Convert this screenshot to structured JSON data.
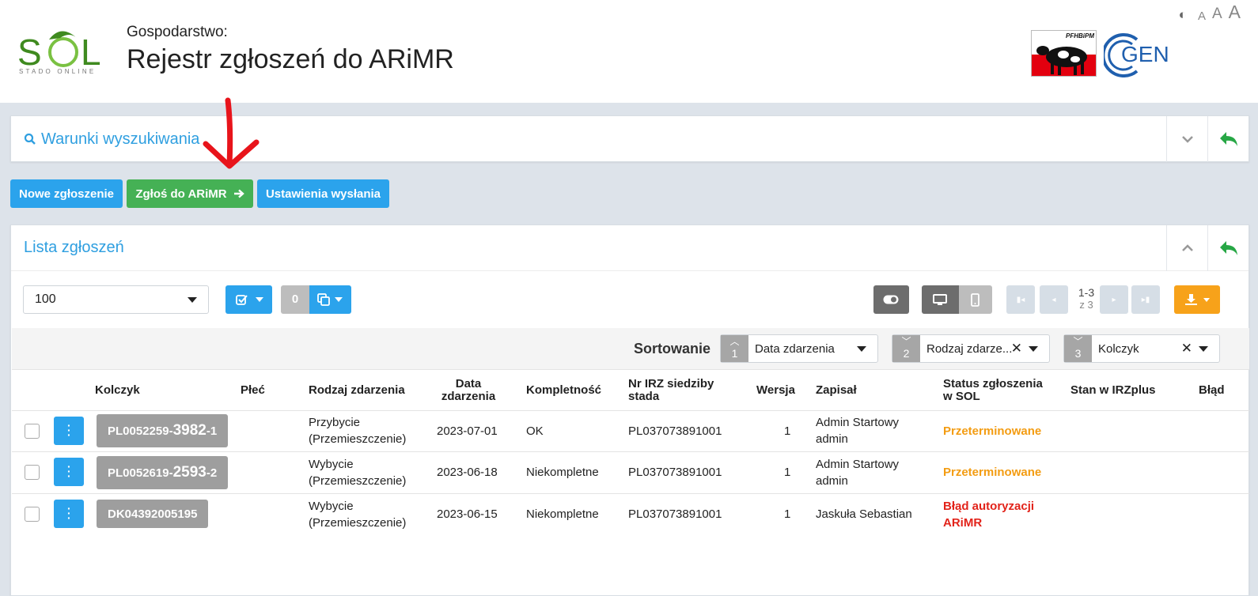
{
  "header": {
    "logo_text": "SOL",
    "logo_subtitle": "STADO ONLINE",
    "farm_label": "Gospodarstwo:",
    "title": "Rejestr zgłoszeń do ARiMR",
    "partner_logo_1": "PFHBiPM",
    "partner_logo_2": "CGEN",
    "a11y": {
      "contrast_icon": "contrast-icon",
      "font_small": "A",
      "font_medium": "A",
      "font_large": "A"
    }
  },
  "search_panel": {
    "title": "Warunki wyszukiwania",
    "icon": "search-icon"
  },
  "actions": {
    "new_report": "Nowe zgłoszenie",
    "send_to_arimr": "Zgłoś do ARiMR",
    "send_settings": "Ustawienia wysłania"
  },
  "list_panel": {
    "title": "Lista zgłoszeń",
    "page_size": "100",
    "selected_count": "0",
    "pagination": {
      "range": "1-3",
      "of_label": "z 3"
    }
  },
  "sorting": {
    "label": "Sortowanie",
    "fields": [
      {
        "num": "1",
        "dir": "asc",
        "value": "Data zdarzenia"
      },
      {
        "num": "2",
        "dir": "desc",
        "value": "Rodzaj zdarze..."
      },
      {
        "num": "3",
        "dir": "desc",
        "value": "Kolczyk"
      }
    ]
  },
  "columns": {
    "ear_tag": "Kolczyk",
    "sex": "Płeć",
    "event_type": "Rodzaj zdarzenia",
    "event_date_1": "Data",
    "event_date_2": "zdarzenia",
    "completeness": "Kompletność",
    "irz_1": "Nr IRZ siedziby",
    "irz_2": "stada",
    "version": "Wersja",
    "saved_by": "Zapisał",
    "status_1": "Status zgłoszenia",
    "status_2": "w SOL",
    "irz_state": "Stan w IRZplus",
    "error": "Błąd"
  },
  "rows": [
    {
      "tag_prefix": "PL0052259-",
      "tag_main": "3982",
      "tag_suffix": "-1",
      "sex": "",
      "event_1": "Przybycie",
      "event_2": "(Przemieszczenie)",
      "date": "2023-07-01",
      "completeness": "OK",
      "irz": "PL037073891001",
      "version": "1",
      "saved_1": "Admin Startowy",
      "saved_2": "admin",
      "status_1": "Przeterminowane",
      "status_2": "",
      "status_color": "#f39c12"
    },
    {
      "tag_prefix": "PL0052619-",
      "tag_main": "2593",
      "tag_suffix": "-2",
      "sex": "",
      "event_1": "Wybycie",
      "event_2": "(Przemieszczenie)",
      "date": "2023-06-18",
      "completeness": "Niekompletne",
      "irz": "PL037073891001",
      "version": "1",
      "saved_1": "Admin Startowy",
      "saved_2": "admin",
      "status_1": "Przeterminowane",
      "status_2": "",
      "status_color": "#f39c12"
    },
    {
      "tag_prefix": "DK04392005195",
      "tag_main": "",
      "tag_suffix": "",
      "sex": "",
      "event_1": "Wybycie",
      "event_2": "(Przemieszczenie)",
      "date": "2023-06-15",
      "completeness": "Niekompletne",
      "irz": "PL037073891001",
      "version": "1",
      "saved_1": "Jaskuła Sebastian",
      "saved_2": "",
      "status_1": "Błąd autoryzacji",
      "status_2": "ARiMR",
      "status_color": "#e2231a"
    }
  ],
  "colors": {
    "accent_blue": "#2ba3ec",
    "green": "#45b155",
    "orange": "#f39c12",
    "red": "#e2231a",
    "annotation_red": "#e8141b"
  }
}
